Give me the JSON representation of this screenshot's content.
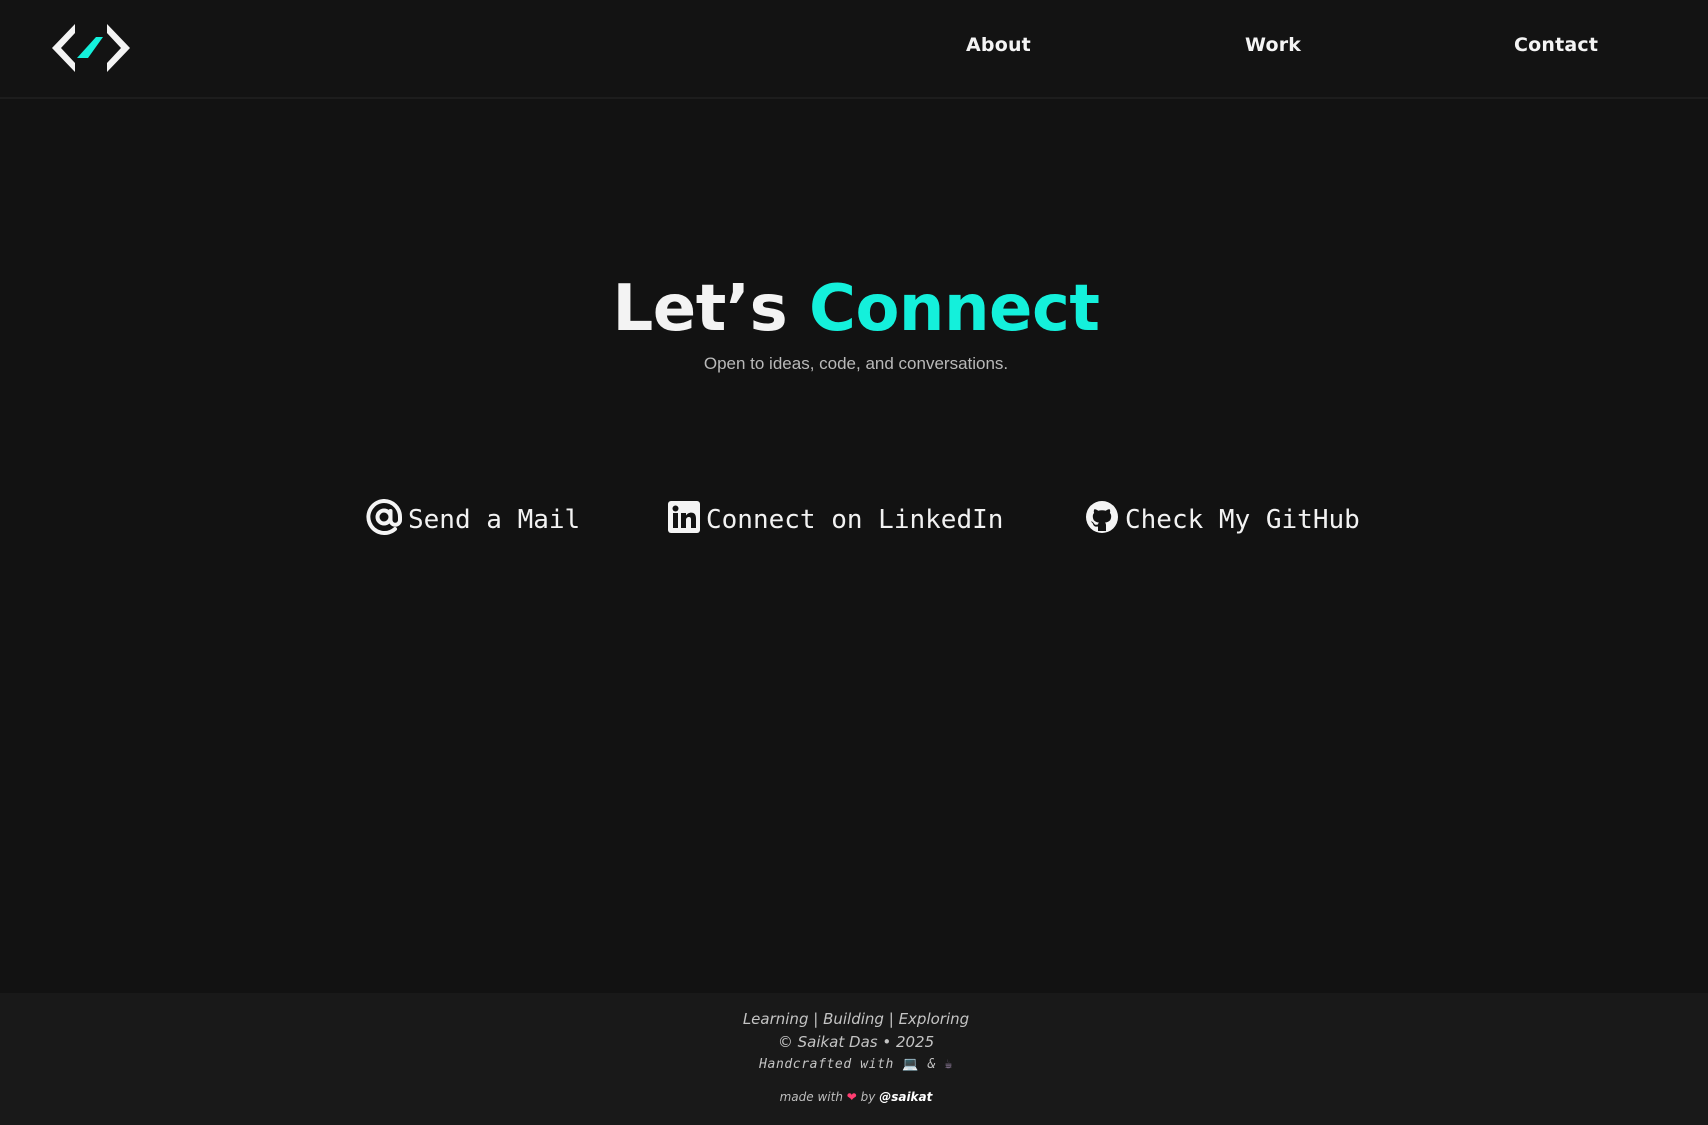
{
  "header": {
    "logo_icon": "code-brackets-logo-icon",
    "nav": {
      "about": "About",
      "work": "Work",
      "contact": "Contact"
    }
  },
  "hero": {
    "title_part1": "Let’s",
    "title_part2": "Connect",
    "subtitle": "Open to ideas, code, and conversations."
  },
  "contacts": {
    "mail": {
      "label": "Send a Mail",
      "icon": "at-sign-icon"
    },
    "linkedin": {
      "label": "Connect on LinkedIn",
      "icon": "linkedin-icon"
    },
    "github": {
      "label": "Check My GitHub",
      "icon": "github-icon"
    }
  },
  "footer": {
    "tagline_1": "Learning",
    "sep": "|",
    "tagline_2": "Building",
    "tagline_3": "Exploring",
    "copyright": "© Saikat Das • 2025",
    "handcrafted": "Handcrafted with",
    "laptop_emoji": "💻",
    "amp": "&",
    "coffee_emoji": "☕",
    "made_with": "made with",
    "heart": "❤",
    "by": "by",
    "handle": "@saikat"
  },
  "colors": {
    "background": "#121212",
    "accent": "#14f0db",
    "footer_bg": "#191919"
  }
}
